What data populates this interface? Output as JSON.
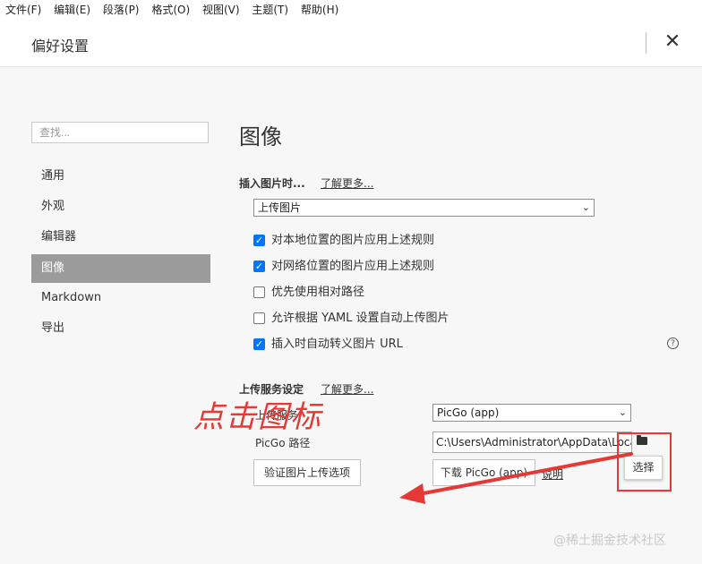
{
  "menu": [
    "文件(F)",
    "编辑(E)",
    "段落(P)",
    "格式(O)",
    "视图(V)",
    "主题(T)",
    "帮助(H)"
  ],
  "header": {
    "title": "偏好设置",
    "close_icon": "close-icon"
  },
  "sidebar": {
    "search_placeholder": "查找...",
    "items": [
      {
        "label": "通用"
      },
      {
        "label": "外观"
      },
      {
        "label": "编辑器"
      },
      {
        "label": "图像",
        "active": true
      },
      {
        "label": "Markdown"
      },
      {
        "label": "导出"
      }
    ]
  },
  "main": {
    "section_title": "图像",
    "insert": {
      "heading": "插入图片时...",
      "learn_more": "了解更多...",
      "action_value": "上传图片",
      "checkboxes": [
        {
          "label": "对本地位置的图片应用上述规则",
          "checked": true
        },
        {
          "label": "对网络位置的图片应用上述规则",
          "checked": true
        },
        {
          "label": "优先使用相对路径",
          "checked": false
        },
        {
          "label": "允许根据 YAML 设置自动上传图片",
          "checked": false
        },
        {
          "label": "插入时自动转义图片 URL",
          "checked": true
        }
      ]
    },
    "upload": {
      "heading": "上传服务设定",
      "learn_more": "了解更多...",
      "service_label": "上传服务",
      "service_value": "PicGo (app)",
      "path_label": "PicGo 路径",
      "path_value": "C:\\Users\\Administrator\\AppData\\Local\\P",
      "verify_button": "验证图片上传选项",
      "download_button": "下载 PicGo (app)",
      "explain_link": "说明",
      "choose_tooltip": "选择"
    }
  },
  "annotation": {
    "text": "点击图标",
    "color": "#e53935"
  },
  "watermark": "@稀土掘金技术社区",
  "colors": {
    "accent_checkbox": "#0075ff",
    "active_nav": "#9b9b9b"
  }
}
